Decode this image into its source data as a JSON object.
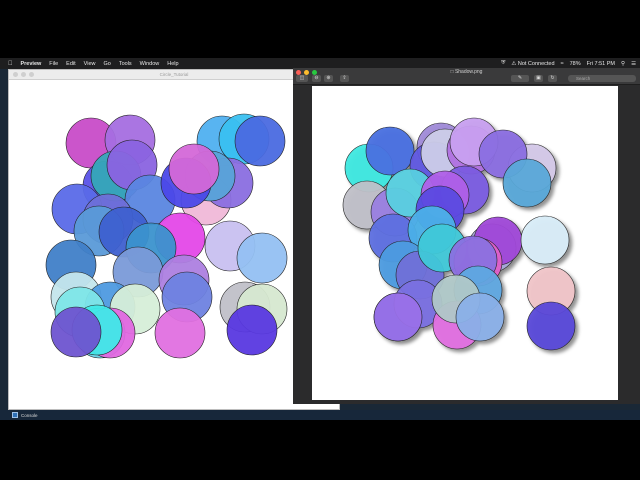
{
  "menubar": {
    "app": "Preview",
    "items": [
      "File",
      "Edit",
      "View",
      "Go",
      "Tools",
      "Window",
      "Help"
    ],
    "status": "Not Connected",
    "battery": "78%",
    "clock": "Fri 7:51 PM"
  },
  "left_window": {
    "title": "Circle_Tutorial"
  },
  "right_window": {
    "title": "Shadow.png",
    "search_placeholder": "Search"
  },
  "taskbar": {
    "console_label": "Console"
  },
  "colors": {
    "menubar": "#1e1e1f",
    "desktop": "#1a2836",
    "taskbar": "#17273a"
  },
  "circles_left": [
    [
      "#c84cc8",
      91,
      143
    ],
    [
      "#a56ee0",
      130,
      140
    ],
    [
      "#5a52e8",
      108,
      186
    ],
    [
      "#35a8b8",
      116,
      176
    ],
    [
      "#4fb0f0",
      222,
      141
    ],
    [
      "#3ac0f0",
      244,
      139
    ],
    [
      "#4a6ae0",
      260,
      141
    ],
    [
      "#8a63e0",
      132,
      165
    ],
    [
      "#5a86e0",
      150,
      200
    ],
    [
      "#f0b8d8",
      206,
      200
    ],
    [
      "#8a6ee0",
      228,
      183
    ],
    [
      "#58a3d8",
      210,
      176
    ],
    [
      "#4b48e8",
      186,
      183
    ],
    [
      "#d468d8",
      194,
      169
    ],
    [
      "#5a6ae8",
      77,
      209
    ],
    [
      "#6e70d8",
      108,
      219
    ],
    [
      "#5a9ad8",
      99,
      231
    ],
    [
      "#3e60d0",
      124,
      232
    ],
    [
      "#e448e8",
      180,
      238
    ],
    [
      "#c8c0f0",
      230,
      246
    ],
    [
      "#94c0f2",
      262,
      258
    ],
    [
      "#3b92ce",
      151,
      248
    ],
    [
      "#4080c8",
      71,
      265
    ],
    [
      "#7a9ad8",
      138,
      272
    ],
    [
      "#ad80e0",
      184,
      280
    ],
    [
      "#c4e6ec",
      76,
      297
    ],
    [
      "#4e9ae0",
      110,
      307
    ],
    [
      "#7ee6e8",
      80,
      312
    ],
    [
      "#6e82e0",
      187,
      297
    ],
    [
      "#d6eed8",
      135,
      309
    ],
    [
      "#c0c0c8",
      245,
      307
    ],
    [
      "#d6e8d0",
      262,
      309
    ],
    [
      "#6ad0e8",
      100,
      333
    ],
    [
      "#e068e0",
      110,
      333
    ],
    [
      "#40e8e8",
      97,
      330
    ],
    [
      "#6e54d0",
      76,
      332
    ],
    [
      "#e070e0",
      180,
      333
    ],
    [
      "#5838e0",
      252,
      330
    ]
  ],
  "circles_right": [
    [
      "#3ee8e0",
      369,
      168
    ],
    [
      "#4a70e0",
      390,
      151
    ],
    [
      "#c0c0c8",
      367,
      205
    ],
    [
      "#9a80e0",
      395,
      212
    ],
    [
      "#a08ad8",
      441,
      147
    ],
    [
      "#6058e0",
      434,
      166
    ],
    [
      "#cccee8",
      445,
      153
    ],
    [
      "#b070e0",
      471,
      150
    ],
    [
      "#c8a0f0",
      474,
      130
    ],
    [
      "#d4c8e8",
      532,
      168
    ],
    [
      "#8a6ee0",
      503,
      154
    ],
    [
      "#58a8d8",
      527,
      183
    ],
    [
      "#5ad0e0",
      410,
      193
    ],
    [
      "#7b5ce0",
      465,
      190
    ],
    [
      "#b060e8",
      445,
      195
    ],
    [
      "#5a4ae0",
      440,
      210
    ],
    [
      "#5e70e0",
      393,
      238
    ],
    [
      "#4cb0e8",
      432,
      230
    ],
    [
      "#4e9ce0",
      403,
      265
    ],
    [
      "#7070d8",
      420,
      275
    ],
    [
      "#40c8d8",
      442,
      248
    ],
    [
      "#a8a8d8",
      492,
      248
    ],
    [
      "#a048d8",
      498,
      241
    ],
    [
      "#d8ecf8",
      545,
      240
    ],
    [
      "#e060c8",
      478,
      262
    ],
    [
      "#8a70e0",
      473,
      260
    ],
    [
      "#5fa8e0",
      478,
      290
    ],
    [
      "#f0c4c8",
      551,
      291
    ],
    [
      "#4a70d8",
      398,
      317
    ],
    [
      "#7a70e0",
      418,
      304
    ],
    [
      "#e070e0",
      457,
      325
    ],
    [
      "#b0c8c8",
      456,
      299
    ],
    [
      "#8ab0e8",
      480,
      317
    ],
    [
      "#9a70e8",
      398,
      317
    ],
    [
      "#5a48d8",
      552,
      326
    ]
  ]
}
